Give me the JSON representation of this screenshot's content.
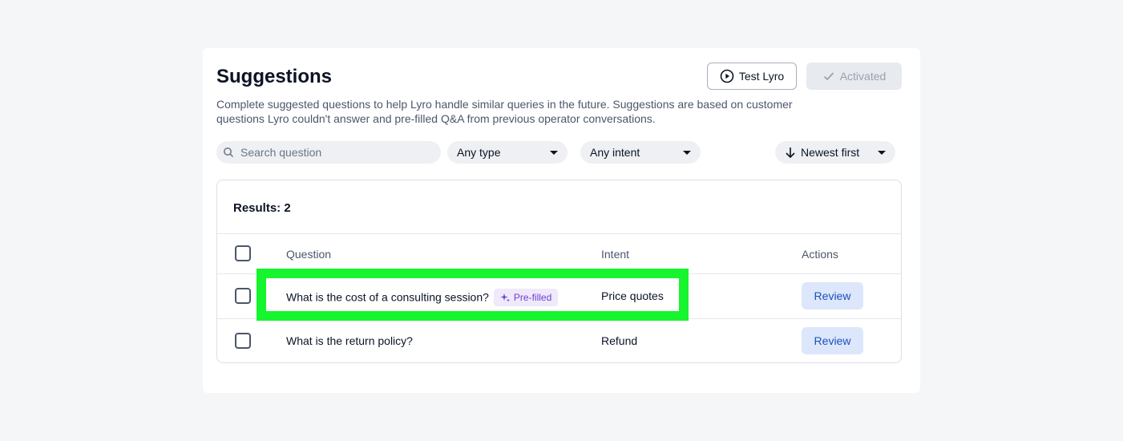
{
  "header": {
    "title": "Suggestions",
    "subtitle": "Complete suggested questions to help Lyro handle similar queries in the future. Suggestions are based on customer questions Lyro couldn't answer and pre-filled Q&A from previous operator conversations.",
    "test_button_label": "Test Lyro",
    "activated_label": "Activated"
  },
  "filters": {
    "search_placeholder": "Search question",
    "type_label": "Any type",
    "intent_label": "Any intent",
    "sort_label": "Newest first"
  },
  "results": {
    "count_label": "Results: 2",
    "columns": {
      "question": "Question",
      "intent": "Intent",
      "actions": "Actions"
    },
    "rows": [
      {
        "question": "What is the cost of a consulting session?",
        "badge": "Pre-filled",
        "intent": "Price quotes",
        "action": "Review"
      },
      {
        "question": "What is the return policy?",
        "intent": "Refund",
        "action": "Review"
      }
    ]
  },
  "colors": {
    "highlight": "#17f52e",
    "badge_text": "#6b3fd4",
    "review_bg": "#dce7fb"
  }
}
